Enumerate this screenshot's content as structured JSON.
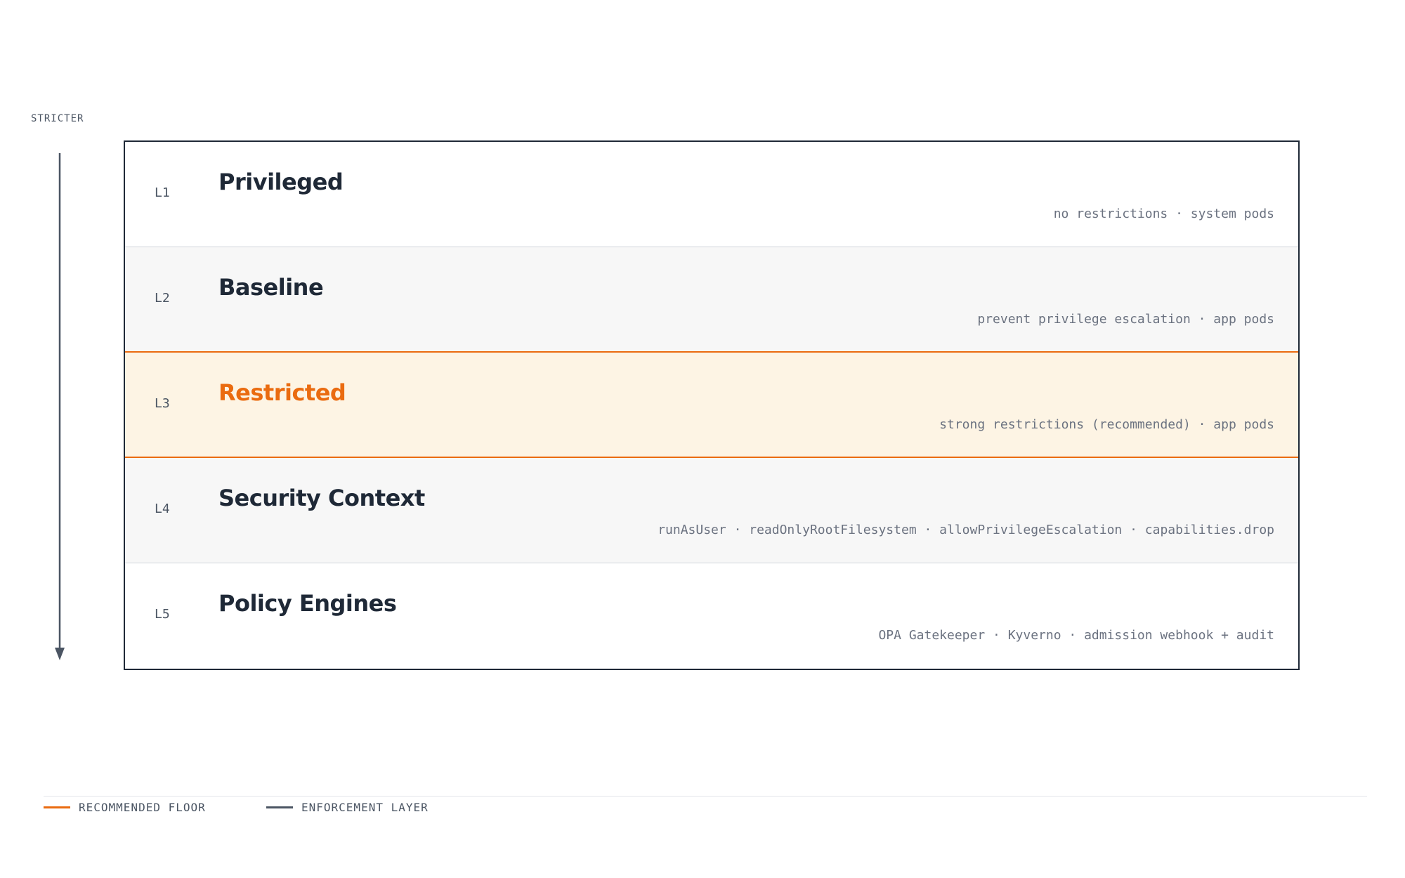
{
  "axis": {
    "label": "STRICTER"
  },
  "layers": [
    {
      "code": "L1",
      "title": "Privileged",
      "description": "no restrictions · system pods",
      "style": "plain"
    },
    {
      "code": "L2",
      "title": "Baseline",
      "description": "prevent privilege escalation · app pods",
      "style": "shaded"
    },
    {
      "code": "L3",
      "title": "Restricted",
      "description": "strong restrictions (recommended) · app pods",
      "style": "highlight"
    },
    {
      "code": "L4",
      "title": "Security Context",
      "description": "runAsUser · readOnlyRootFilesystem · allowPrivilegeEscalation · capabilities.drop",
      "style": "shaded"
    },
    {
      "code": "L5",
      "title": "Policy Engines",
      "description": "OPA Gatekeeper · Kyverno · admission webhook + audit",
      "style": "plain"
    }
  ],
  "legend": {
    "recommended_label": "RECOMMENDED FLOOR",
    "enforcement_label": "ENFORCEMENT LAYER"
  },
  "colors": {
    "accent": "#ea6b10",
    "ink": "#1f2937",
    "enforcement": "#4b5563",
    "highlight_bg": "#fdf4e4",
    "shaded_bg": "#f7f7f7"
  }
}
